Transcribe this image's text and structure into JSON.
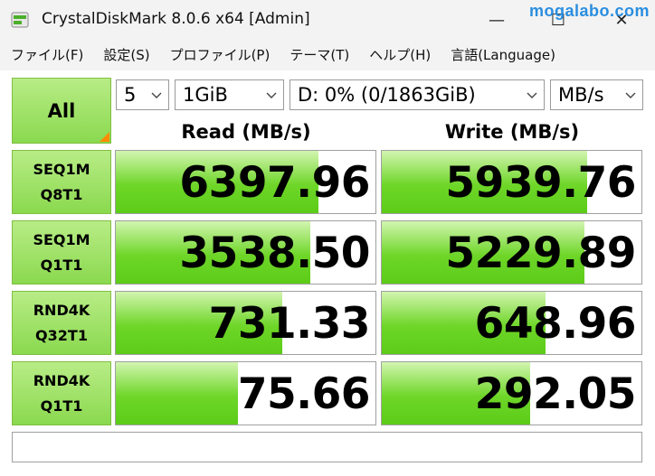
{
  "window": {
    "title": "CrystalDiskMark 8.0.6 x64 [Admin]",
    "watermark": "mogalabo.com",
    "minimize_glyph": "—",
    "maximize_glyph": "☐",
    "close_glyph": "✕"
  },
  "menu": [
    "ファイル(F)",
    "設定(S)",
    "プロファイル(P)",
    "テーマ(T)",
    "ヘルプ(H)",
    "言語(Language)"
  ],
  "controls": {
    "all_label": "All",
    "count": "5",
    "size": "1GiB",
    "drive": "D: 0% (0/1863GiB)",
    "unit": "MB/s"
  },
  "headers": {
    "read": "Read (MB/s)",
    "write": "Write (MB/s)"
  },
  "tests": [
    {
      "line1": "SEQ1M",
      "line2": "Q8T1",
      "read": "6397.96",
      "write": "5939.76",
      "read_fill": 0.78,
      "write_fill": 0.79
    },
    {
      "line1": "SEQ1M",
      "line2": "Q1T1",
      "read": "3538.50",
      "write": "5229.89",
      "read_fill": 0.75,
      "write_fill": 0.78
    },
    {
      "line1": "RND4K",
      "line2": "Q32T1",
      "read": "731.33",
      "write": "648.96",
      "read_fill": 0.64,
      "write_fill": 0.63
    },
    {
      "line1": "RND4K",
      "line2": "Q1T1",
      "read": "75.66",
      "write": "292.05",
      "read_fill": 0.47,
      "write_fill": 0.57
    }
  ],
  "comment": "",
  "colors": {
    "button_green": "#8ad94f",
    "bar_green": "#5ccc18",
    "corner_orange": "#ff8c00",
    "watermark_blue": "#2a8ee0"
  }
}
